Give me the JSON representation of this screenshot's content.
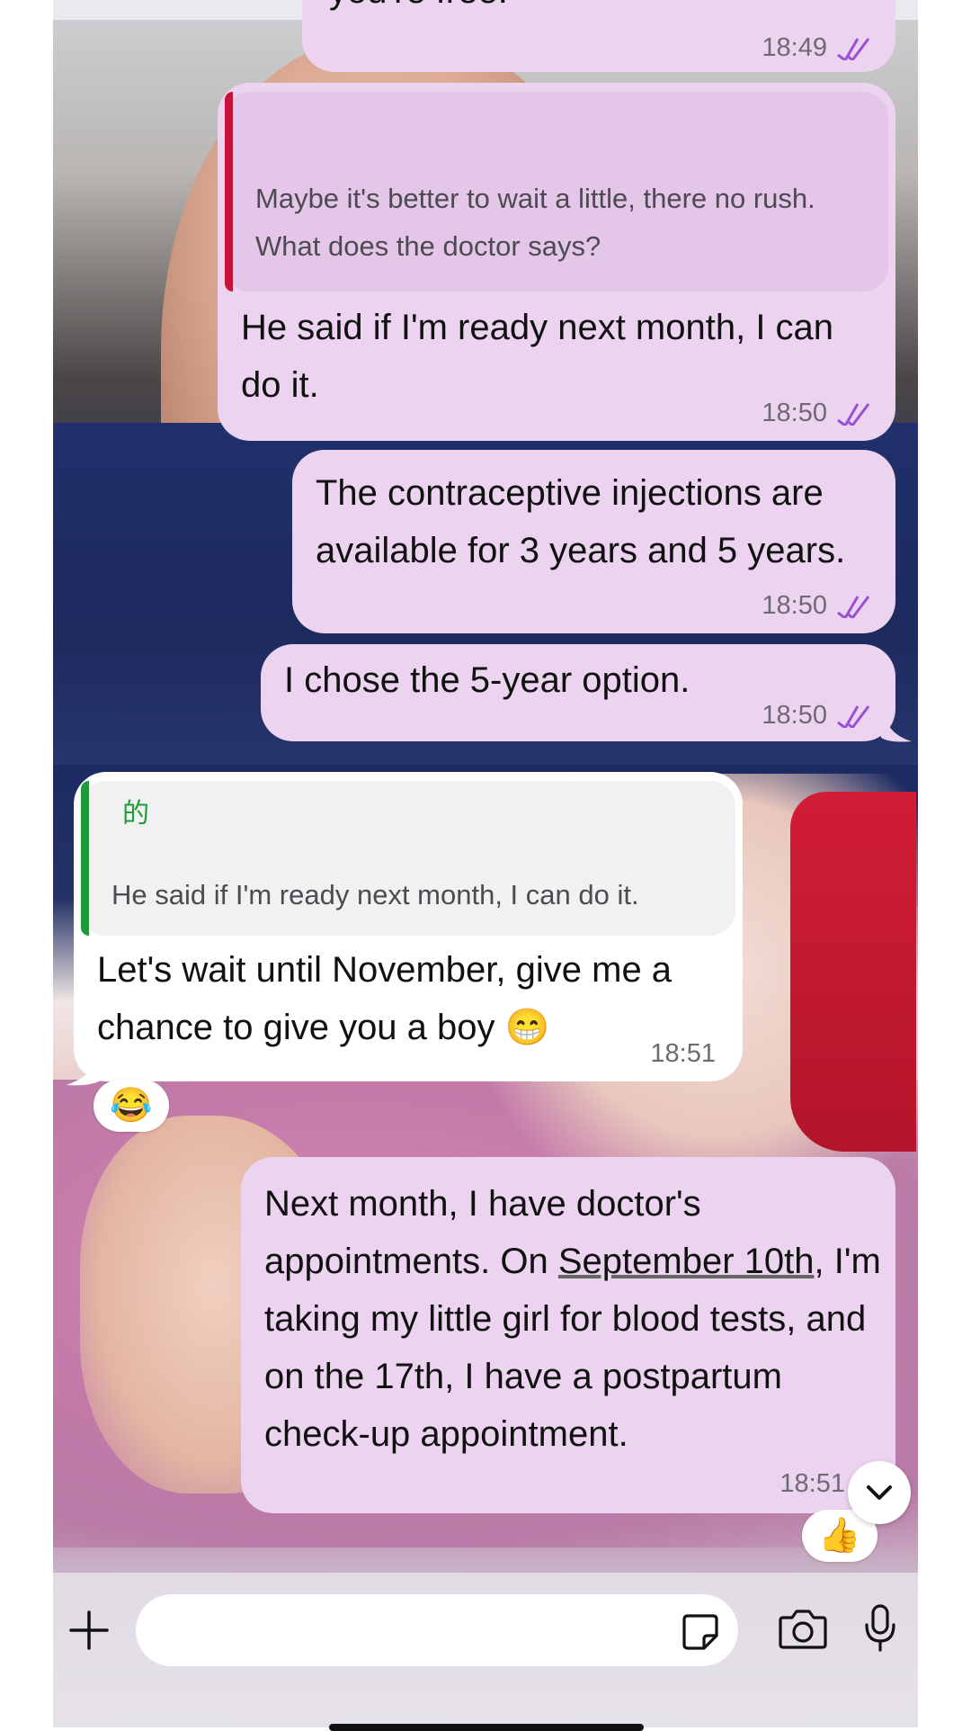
{
  "header": {
    "status_text": ""
  },
  "messages": [
    {
      "id": "m1",
      "direction": "out",
      "text": "you're free.",
      "time": "18:49",
      "status": "read"
    },
    {
      "id": "m2",
      "direction": "out",
      "quote_text": "Maybe it's better to wait a little, there no rush. What does the doctor says?",
      "text": "He said if I'm ready next month, I can do it.",
      "time": "18:50",
      "status": "read"
    },
    {
      "id": "m3",
      "direction": "out",
      "text": "The contraceptive injections are available for 3 years and 5 years.",
      "time": "18:50",
      "status": "read"
    },
    {
      "id": "m4",
      "direction": "out",
      "text": "I chose the 5-year option.",
      "time": "18:50",
      "status": "read"
    },
    {
      "id": "m5",
      "direction": "in",
      "quote_author": "的",
      "quote_text": "He said if I'm ready next month, I can do it.",
      "text": "Let's wait until November, give me a chance to give you a boy 😁",
      "time": "18:51",
      "reaction": "😂"
    },
    {
      "id": "m6",
      "direction": "out",
      "text_before_link": "Next month, I have doctor's appointments. On ",
      "link_text": "September 10th",
      "text_after_link": ", I'm taking my little girl for blood tests, and on the 17th, I have a postpartum check-up appointment.",
      "time": "18:51",
      "status": "read",
      "reaction": "👍"
    }
  ],
  "composer": {
    "placeholder": "",
    "icons": [
      "plus-icon",
      "sticker-icon",
      "camera-icon",
      "microphone-icon"
    ]
  },
  "colors": {
    "outgoing_bubble": "#ecd3f0",
    "incoming_bubble": "#ffffff",
    "read_ticks": "#9b4fd6",
    "quote_bar_out": "#c8123a",
    "quote_bar_in": "#1f9a3a"
  }
}
